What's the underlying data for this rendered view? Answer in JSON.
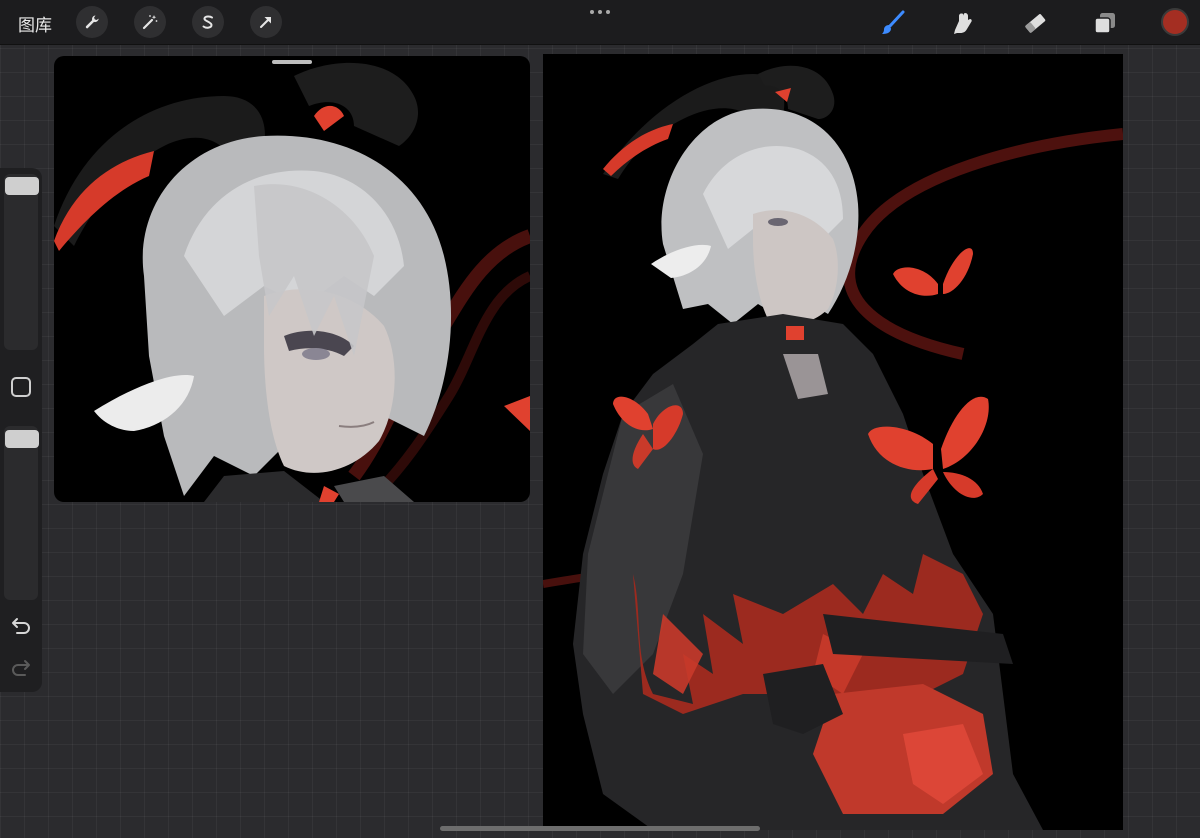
{
  "toolbar": {
    "gallery_label": "图库",
    "left_tools": [
      "wrench-icon",
      "magic-wand-icon",
      "selection-s-icon",
      "transform-arrow-icon"
    ],
    "more_icon": "ellipsis-icon",
    "right_tools": [
      "brush-icon",
      "smudge-icon",
      "eraser-icon",
      "layers-icon"
    ],
    "active_tool": "brush",
    "active_tool_color": "#3d8bff",
    "current_color": "#a42e22"
  },
  "sidebar": {
    "brush_size_icon": "slider-thumb",
    "opacity_icon": "slider-thumb",
    "modifier_icon": "square-modifier-icon",
    "undo_icon": "undo-icon",
    "redo_icon": "redo-icon"
  },
  "canvas": {
    "reference_panel": "reference-artwork-closeup",
    "main_panel": "main-artwork",
    "palette": {
      "background": "#000000",
      "hair": "#c9c9cb",
      "horn": "#1c1c1c",
      "accent_red": "#e0412f",
      "coat": "#2a2a2c"
    }
  }
}
